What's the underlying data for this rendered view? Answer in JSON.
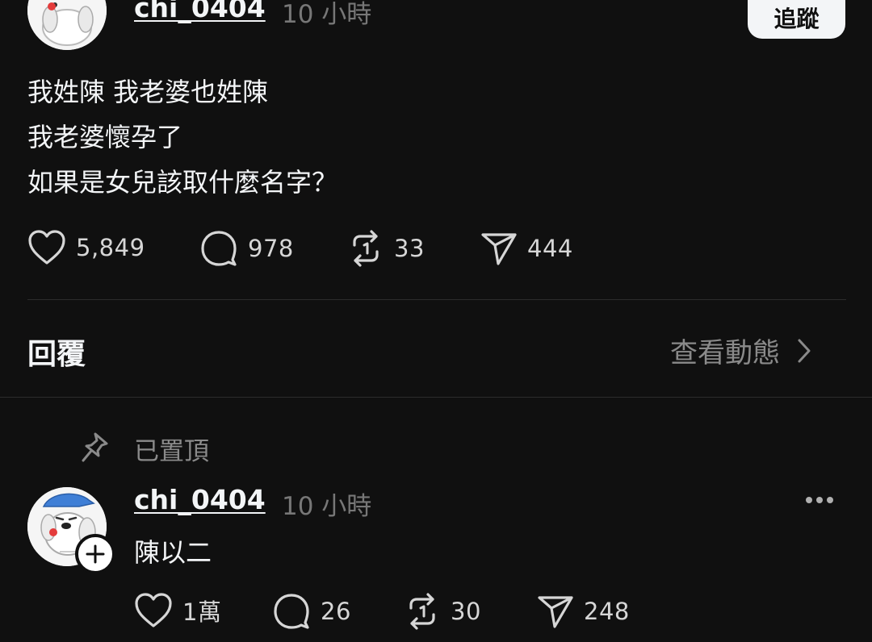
{
  "post": {
    "username": "chi_0404",
    "timestamp": "10 小時",
    "follow_label": "追蹤",
    "lines": [
      "我姓陳 我老婆也姓陳",
      "我老婆懷孕了",
      "如果是女兒該取什麼名字？"
    ],
    "actions": {
      "likes": "5,849",
      "comments": "978",
      "reposts": "33",
      "shares": "444"
    }
  },
  "replies_section": {
    "title": "回覆",
    "view_activity": "查看動態"
  },
  "pinned_reply": {
    "pinned_label": "已置頂",
    "username": "chi_0404",
    "timestamp": "10 小時",
    "text": "陳以二",
    "actions": {
      "likes": "1萬",
      "comments": "26",
      "reposts": "30",
      "shares": "248"
    }
  },
  "icons": {
    "heart": "heart-icon",
    "comment": "comment-icon",
    "repost": "repost-icon",
    "share": "share-icon",
    "pin": "pin-icon",
    "chevron": "chevron-right-icon",
    "plus": "plus-icon",
    "more": "more-icon"
  },
  "colors": {
    "background": "#101010",
    "text_primary": "#f3f5f7",
    "text_secondary": "#777777",
    "divider": "#2c2c2c"
  }
}
